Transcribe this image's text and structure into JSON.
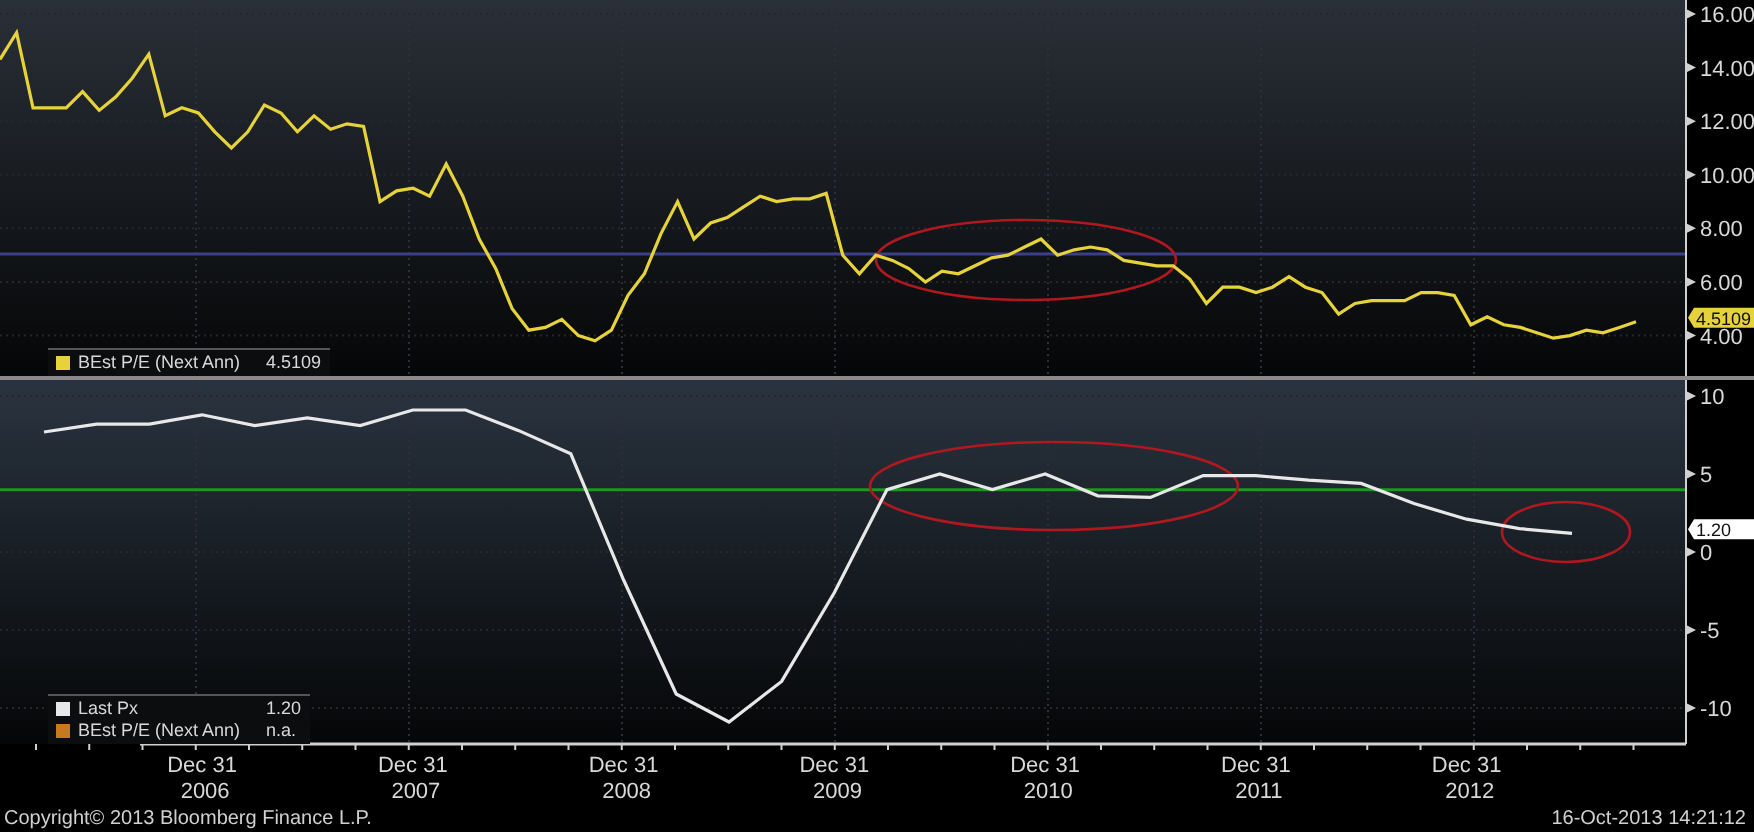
{
  "panels": [
    {
      "chart_data": {
        "type": "line",
        "grid": true,
        "ylim": [
          2.49,
          16.52
        ],
        "yticks": [
          {
            "value": 4,
            "label": "4.00"
          },
          {
            "value": 6,
            "label": "6.00"
          },
          {
            "value": 8,
            "label": "8.00"
          },
          {
            "value": 10,
            "label": "10.00"
          },
          {
            "value": 12,
            "label": "12.00"
          },
          {
            "value": 14,
            "label": "14.00"
          },
          {
            "value": 16,
            "label": "16.00"
          }
        ],
        "series": [
          {
            "name": "BEst P/E (Next Ann)",
            "color": "#e6d23a",
            "values": [
              14.3,
              15.3,
              12.5,
              12.5,
              12.5,
              13.1,
              12.4,
              12.9,
              13.6,
              14.5,
              12.2,
              12.5,
              12.3,
              11.6,
              11.0,
              11.6,
              12.6,
              12.3,
              11.6,
              12.2,
              11.7,
              11.9,
              11.8,
              9.0,
              9.4,
              9.5,
              9.2,
              10.4,
              9.2,
              7.6,
              6.5,
              5.0,
              4.2,
              4.3,
              4.6,
              4.0,
              3.8,
              4.2,
              5.5,
              6.3,
              7.8,
              9.0,
              7.6,
              8.2,
              8.4,
              8.8,
              9.2,
              9.0,
              9.1,
              9.1,
              9.3,
              7.0,
              6.3,
              7.0,
              6.8,
              6.5,
              6.0,
              6.4,
              6.3,
              6.6,
              6.9,
              7.0,
              7.3,
              7.6,
              7.0,
              7.2,
              7.3,
              7.2,
              6.8,
              6.7,
              6.6,
              6.6,
              6.1,
              5.2,
              5.8,
              5.8,
              5.6,
              5.8,
              6.2,
              5.8,
              5.6,
              4.8,
              5.2,
              5.3,
              5.3,
              5.3,
              5.6,
              5.6,
              5.5,
              4.4,
              4.7,
              4.4,
              4.3,
              4.1,
              3.9,
              4.0,
              4.2,
              4.1,
              4.3,
              4.51
            ]
          }
        ],
        "ref_lines": [
          {
            "axis": "y",
            "value": 7.04,
            "color": "#3a3f8c"
          }
        ]
      },
      "legend": [
        {
          "value": "4.5109"
        }
      ],
      "value_tag": {
        "text": "4.5109",
        "color": "#e6d23a"
      }
    },
    {
      "chart_data": {
        "type": "line",
        "grid": true,
        "ylim": [
          -12.31,
          11.03
        ],
        "yticks": [
          {
            "value": -10,
            "label": "-10"
          },
          {
            "value": -5,
            "label": "-5"
          },
          {
            "value": 0,
            "label": "0"
          },
          {
            "value": 5,
            "label": "5"
          },
          {
            "value": 10,
            "label": "10"
          }
        ],
        "categories": [
          null,
          null,
          null,
          "Dec 31 2006",
          null,
          null,
          null,
          "Dec 31 2007",
          null,
          null,
          null,
          "Dec 31 2008",
          null,
          null,
          null,
          "Dec 31 2009",
          null,
          null,
          null,
          "Dec 31 2010",
          null,
          null,
          null,
          "Dec 31 2011",
          null,
          null,
          null,
          "Dec 31 2012",
          null,
          null
        ],
        "series": [
          {
            "name": "Last Px",
            "color": "#e8e8e8",
            "values": [
              7.7,
              8.2,
              8.2,
              8.8,
              8.1,
              8.6,
              8.1,
              9.1,
              9.1,
              7.8,
              6.3,
              -1.8,
              -9.1,
              -10.9,
              -8.3,
              -2.6,
              4.0,
              5.0,
              4.0,
              5.0,
              3.6,
              3.5,
              4.9,
              4.9,
              4.6,
              4.4,
              3.1,
              2.1,
              1.5,
              1.2
            ]
          }
        ],
        "ref_lines": [
          {
            "axis": "y",
            "value": 4.0,
            "color": "#1a9a1a"
          }
        ]
      },
      "legend": [
        {
          "value": "1.20"
        },
        {
          "label": "BEst P/E (Next Ann)",
          "value": "n.a.",
          "color": "#c8781e"
        }
      ],
      "value_tag": {
        "text": "1.20",
        "color": "#ffffff"
      }
    }
  ],
  "footer": {
    "copyright": "Copyright© 2013 Bloomberg Finance L.P.",
    "timestamp": "16-Oct-2013 14:21:12"
  }
}
